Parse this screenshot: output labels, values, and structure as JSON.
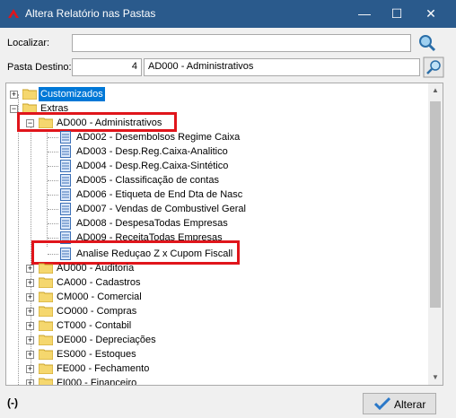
{
  "window": {
    "title": "Altera Relatório nas Pastas",
    "min_glyph": "—",
    "max_glyph": "☐",
    "close_glyph": "✕"
  },
  "search": {
    "label": "Localizar:",
    "value": ""
  },
  "dest": {
    "label": "Pasta Destino:",
    "number": "4",
    "name": "AD000 - Administrativos"
  },
  "tree": {
    "customizados": "Customizados",
    "extras": "Extras",
    "ad000": "AD000 - Administrativos",
    "reports": [
      "AD002 - Desembolsos Regime Caixa",
      "AD003 - Desp.Reg.Caixa-Analitico",
      "AD004 - Desp.Reg.Caixa-Sintético",
      "AD005 - Classificação de contas",
      "AD006 - Etiqueta de End Dta de Nasc",
      "AD007 - Vendas de Combustivel Geral",
      "AD008 - DespesaTodas Empresas",
      "AD009 - ReceitaTodas Empresas",
      "Analise Reduçao Z x Cupom Fiscall"
    ],
    "folders": [
      "AU000 - Auditoria",
      "CA000 - Cadastros",
      "CM000 - Comercial",
      "CO000 - Compras",
      "CT000 - Contabil",
      "DE000 - Depreciações",
      "ES000 - Estoques",
      "FE000 - Fechamento",
      "FI000 - Financeiro"
    ]
  },
  "status": "(-)",
  "button": {
    "label": "Alterar"
  },
  "colors": {
    "titlebar": "#2a5a8c",
    "highlight": "#e0151b",
    "selection": "#0078d7",
    "folder": "#f5d76e"
  }
}
